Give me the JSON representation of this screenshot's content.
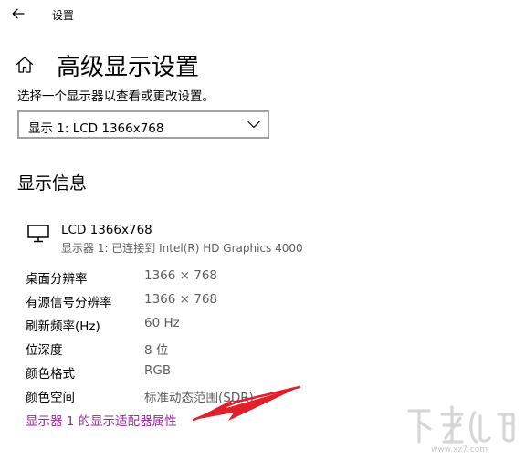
{
  "window": {
    "title": "设置"
  },
  "page": {
    "title": "高级显示设置",
    "instruction": "选择一个显示器以查看或更改设置。"
  },
  "display_select": {
    "selected": "显示 1: LCD 1366x768"
  },
  "display_info": {
    "section_title": "显示信息",
    "monitor_name": "LCD 1366x768",
    "monitor_status": "显示器 1: 已连接到 Intel(R) HD Graphics 4000",
    "rows": [
      {
        "label": "桌面分辨率",
        "value": "1366 × 768"
      },
      {
        "label": "有源信号分辨率",
        "value": "1366 × 768"
      },
      {
        "label": "刷新频率(Hz)",
        "value": "60 Hz"
      },
      {
        "label": "位深度",
        "value": "8 位"
      },
      {
        "label": "颜色格式",
        "value": "RGB"
      },
      {
        "label": "颜色空间",
        "value": "标准动态范围(SDR)"
      }
    ],
    "adapter_link": "显示器 1 的显示适配器属性"
  },
  "watermark": {
    "url": "www.xz7.com"
  },
  "colors": {
    "link": "#a020a8",
    "annotation_arrow": "#e0212a",
    "secondary_text": "#5d5d5d"
  },
  "icons": {
    "back": "back-arrow-icon",
    "home": "home-icon",
    "dropdown": "chevron-down-icon",
    "monitor": "monitor-icon"
  }
}
